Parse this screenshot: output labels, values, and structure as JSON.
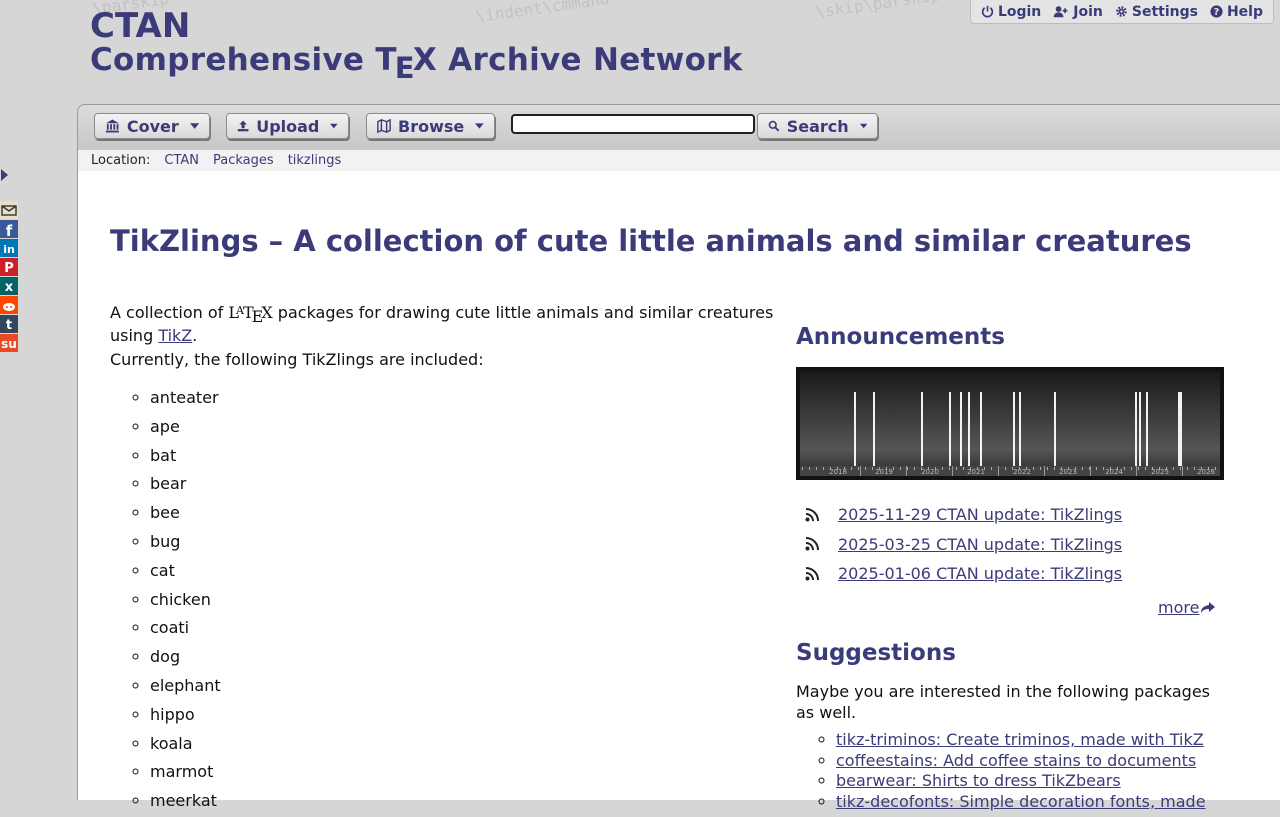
{
  "header": {
    "site_short": "CTAN",
    "site_long_prefix": "Comprehensive T",
    "site_long_sub": "E",
    "site_long_suffix": "X Archive Network",
    "watermark": [
      "\\parskip",
      "\\indent\\cmmand",
      "\\skip\\parskip"
    ]
  },
  "top_menu": {
    "login": "Login",
    "join": "Join",
    "settings": "Settings",
    "help": "Help"
  },
  "nav": {
    "cover": "Cover",
    "upload": "Upload",
    "browse": "Browse",
    "search_value": "",
    "search": "Search"
  },
  "location": {
    "label": "Location:",
    "crumbs": [
      "CTAN",
      "Packages",
      "tikzlings"
    ]
  },
  "page": {
    "title": "TikZlings – A collection of cute little animals and similar creatures",
    "desc_pre": "A collection of ",
    "latex_L": "L",
    "latex_A": "A",
    "latex_T": "T",
    "latex_E": "E",
    "latex_X": "X",
    "desc_mid": " packages for drawing cute little animals and similar creatures using ",
    "desc_link": "TikZ",
    "desc_post": ".",
    "currently": "Currently, the following TikZlings are included:",
    "animals": [
      "anteater",
      "ape",
      "bat",
      "bear",
      "bee",
      "bug",
      "cat",
      "chicken",
      "coati",
      "dog",
      "elephant",
      "hippo",
      "koala",
      "marmot",
      "meerkat"
    ]
  },
  "announcements": {
    "heading": "Announcements",
    "timeline_years": [
      "2018",
      "2019",
      "2020",
      "2021",
      "2022",
      "2023",
      "2024",
      "2025",
      "2026"
    ],
    "items": [
      "2025-11-29 CTAN update: TikZlings",
      "2025-03-25 CTAN update: TikZlings",
      "2025-01-06 CTAN update: TikZlings"
    ],
    "more": "more"
  },
  "suggestions": {
    "heading": "Suggestions",
    "intro": "Maybe you are interested in the following packages as well.",
    "items": [
      "tikz-triminos: Create triminos, made with TikZ",
      "coffeestains: Add coffee stains to documents",
      "bearwear: Shirts to dress TikZbears",
      "tikz-decofonts: Simple decoration fonts, made"
    ]
  },
  "share": {
    "icons": [
      "email-icon",
      "facebook-icon",
      "linkedin-icon",
      "pinterest-icon",
      "xing-icon",
      "reddit-icon",
      "tumblr-icon",
      "stumbleupon-icon"
    ],
    "colors": [
      "#e6dfc6",
      "#3b5998",
      "#0077b5",
      "#cb2027",
      "#026466",
      "#ff4500",
      "#35465c",
      "#eb4924"
    ]
  },
  "colors": {
    "brand": "#3b3b7a",
    "link": "#3b3b7a"
  }
}
